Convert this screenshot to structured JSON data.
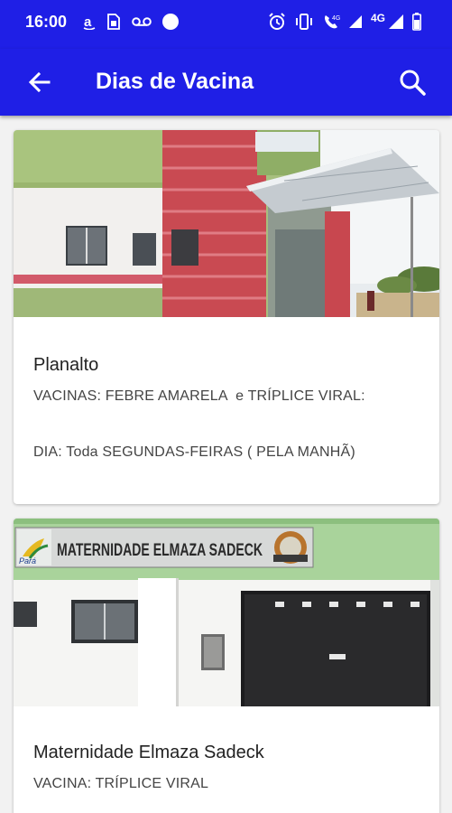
{
  "status_bar": {
    "time": "16:00",
    "left_icons": [
      "amazon-icon",
      "sim-card-icon",
      "voicemail-icon",
      "dot-icon"
    ],
    "right_icons": [
      "alarm-icon",
      "vibrate-icon",
      "wifi-calling-icon",
      "signal-4g-icon",
      "network-label",
      "signal-icon",
      "battery-icon"
    ],
    "network_label": "4G"
  },
  "app_bar": {
    "title": "Dias de Vacina",
    "background": "#1f1fe6",
    "back_icon": "arrow-left-icon",
    "search_icon": "search-icon"
  },
  "cards": [
    {
      "image": "health-center-building-photo",
      "title": "Planalto",
      "line1": "VACINAS: FEBRE AMARELA  e TRÍPLICE VIRAL:",
      "line2": "DIA: Toda SEGUNDAS-FEIRAS ( PELA MANHÃ)"
    },
    {
      "image": "maternity-building-photo",
      "sign_text": "MATERNIDADE ELMAZA SADECK",
      "sign_logo_text": "Pará",
      "title": "Maternidade Elmaza Sadeck",
      "line1": "VACINA: TRÍPLICE VIRAL"
    }
  ]
}
